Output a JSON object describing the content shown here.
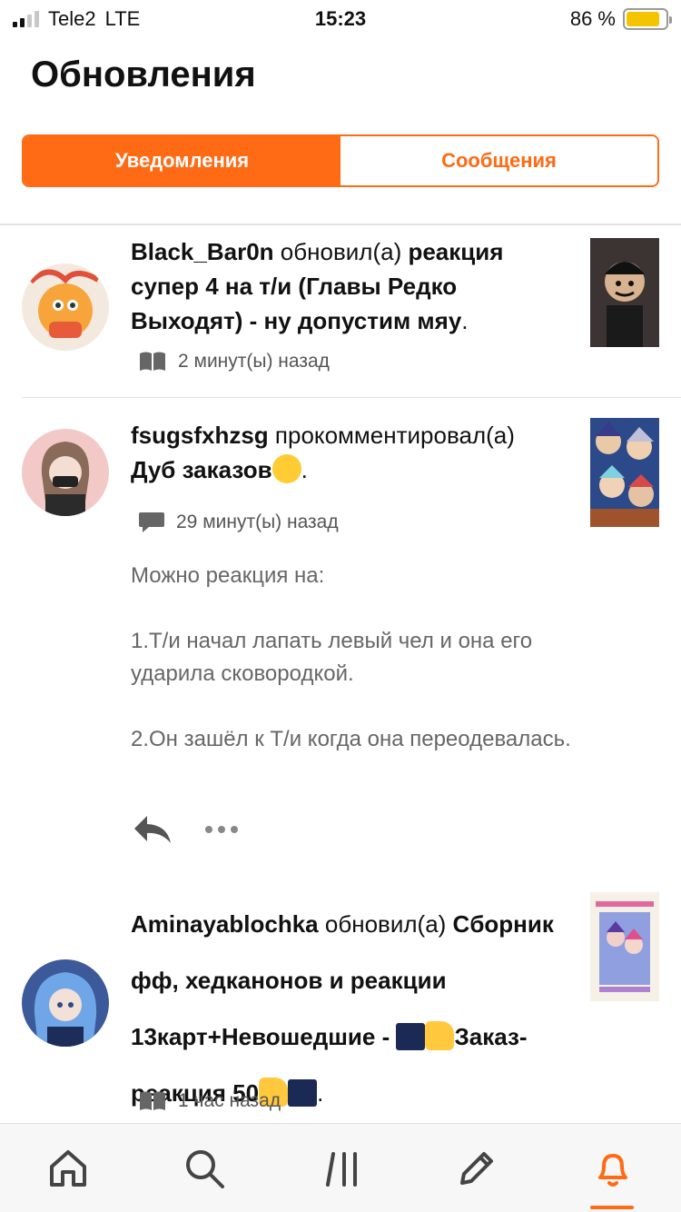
{
  "status_bar": {
    "carrier": "Tele2",
    "network": "LTE",
    "time": "15:23",
    "battery_percent": "86 %",
    "battery_level": 0.86
  },
  "page": {
    "title": "Обновления"
  },
  "tabs": [
    {
      "label": "Уведомления",
      "active": true
    },
    {
      "label": "Сообщения",
      "active": false
    }
  ],
  "feed": [
    {
      "username": "Black_Bar0n",
      "action": " обновил(а) ",
      "target": "реакция супер 4 на т/и (Главы Редко Выходят) - ну допустим мяу",
      "trail": ".",
      "time": "2 минут(ы) назад",
      "meta_icon": "book-icon"
    },
    {
      "username": "fsugsfxhzsg",
      "action": " прокомментировал(а) ",
      "target": "Дуб заказов",
      "trail": ".",
      "time": "29 минут(ы) назад",
      "meta_icon": "comment-icon",
      "comment": "Можно реакция на:\n\n 1.Т/и начал лапать левый чел и она его ударила сковородкой.\n\n2.Он зашёл к Т/и когда она переодевалась."
    },
    {
      "username": "Aminayablochka",
      "action": " обновил(а) ",
      "target_part1": "Cбopник фф, хедканонов и реакции 13карт+Невошедшие - ",
      "target_part2": "Заказ-реакция 50",
      "trail": ".",
      "time": "1 час назад",
      "meta_icon": "book-icon"
    }
  ],
  "colors": {
    "accent": "#ff6a14",
    "text": "#111111",
    "muted": "#666666"
  },
  "tabbar": [
    {
      "name": "home-icon"
    },
    {
      "name": "search-icon"
    },
    {
      "name": "library-icon"
    },
    {
      "name": "pencil-icon"
    },
    {
      "name": "bell-icon",
      "active": true
    }
  ]
}
